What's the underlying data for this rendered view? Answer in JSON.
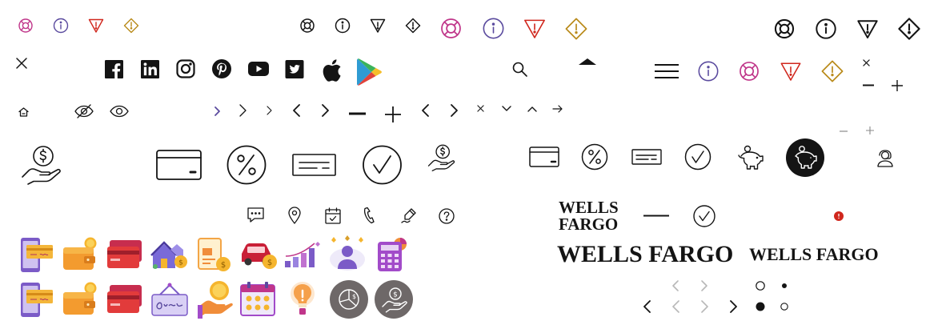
{
  "brand": {
    "logo_stacked_line1": "WELLS",
    "logo_stacked_line2": "FARGO",
    "logo_large": "WELLS FARGO",
    "logo_medium": "WELLS FARGO"
  },
  "colors": {
    "ink": "#141414",
    "pink": "#c0368a",
    "purple": "#5a4a9e",
    "red": "#d0271d",
    "gold": "#b98a1a",
    "alert_dot": "#d0271d",
    "disabled": "#b8b8b8",
    "dark_circle": "#6e6868"
  },
  "icon_rows": {
    "status_small": [
      "lifebuoy-icon",
      "info-icon",
      "error-triangle-icon",
      "warning-diamond-icon"
    ],
    "status_mono": [
      "lifebuoy-icon",
      "info-icon",
      "error-triangle-icon",
      "warning-diamond-icon"
    ],
    "status_color_medium": [
      "lifebuoy-icon",
      "info-icon",
      "error-triangle-icon",
      "warning-diamond-icon"
    ],
    "status_mono_large": [
      "lifebuoy-icon",
      "info-icon",
      "error-triangle-icon",
      "warning-diamond-icon"
    ],
    "social": [
      "facebook-icon",
      "linkedin-icon",
      "instagram-icon",
      "pinterest-icon",
      "youtube-icon",
      "twitter-icon",
      "apple-icon",
      "google-play-icon"
    ],
    "controls": [
      "home-icon",
      "eye-off-icon",
      "eye-icon",
      "chevron-right-icon",
      "minus-icon",
      "plus-icon",
      "close-icon",
      "chevron-down-icon",
      "chevron-up-icon",
      "arrow-right-icon"
    ],
    "banking_large": [
      "money-hand-icon",
      "credit-card-icon",
      "percent-icon",
      "check-icon",
      "checkmark-circle-icon",
      "money-hand-icon"
    ],
    "banking_small": [
      "credit-card-icon",
      "percent-icon",
      "check-icon",
      "checkmark-circle-icon",
      "piggy-bank-icon",
      "piggy-bank-icon",
      "user-headset-icon"
    ],
    "contact": [
      "chat-icon",
      "location-pin-icon",
      "calendar-check-icon",
      "phone-icon",
      "signature-icon",
      "help-icon"
    ],
    "illustrations_row1": [
      "mobile-deposit-illustration",
      "wallet-illustration",
      "cards-illustration",
      "home-loan-illustration",
      "bill-illustration",
      "auto-loan-illustration",
      "growth-chart-illustration",
      "rewards-person-illustration",
      "calculator-illustration"
    ],
    "illustrations_row2": [
      "mobile-deposit-illustration",
      "wallet-illustration",
      "cards-illustration",
      "open-sign-illustration",
      "coin-hand-illustration",
      "calendar-coins-illustration",
      "lightbulb-illustration",
      "chart-badge-illustration",
      "money-hand-badge-illustration"
    ]
  },
  "pagination": {
    "dots": [
      "active",
      "inactive"
    ]
  }
}
